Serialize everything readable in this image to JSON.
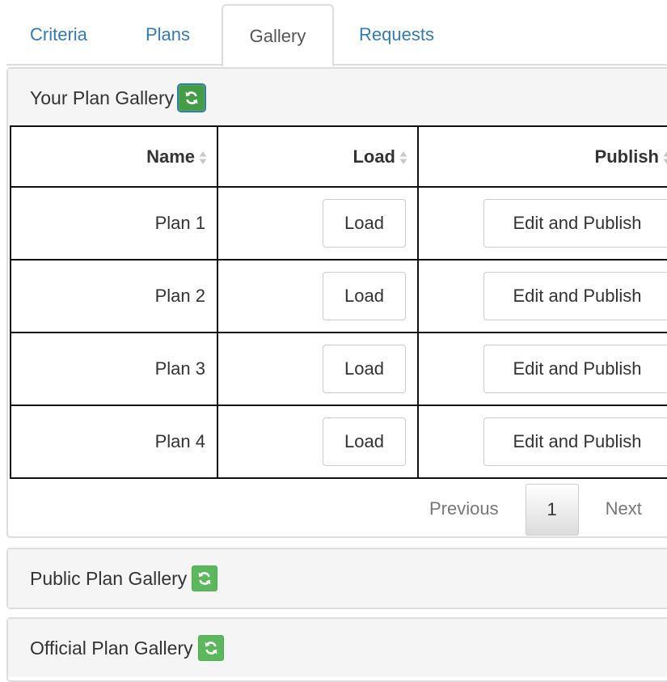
{
  "tabs": {
    "criteria": "Criteria",
    "plans": "Plans",
    "gallery": "Gallery",
    "requests": "Requests",
    "active": "Gallery"
  },
  "your_gallery": {
    "title": "Your Plan Gallery",
    "columns": {
      "name": "Name",
      "load": "Load",
      "publish": "Publish"
    },
    "rows": [
      {
        "name": "Plan 1",
        "load_label": "Load",
        "publish_label": "Edit and Publish"
      },
      {
        "name": "Plan 2",
        "load_label": "Load",
        "publish_label": "Edit and Publish"
      },
      {
        "name": "Plan 3",
        "load_label": "Load",
        "publish_label": "Edit and Publish"
      },
      {
        "name": "Plan 4",
        "load_label": "Load",
        "publish_label": "Edit and Publish"
      }
    ],
    "pagination": {
      "previous": "Previous",
      "current": "1",
      "next": "Next"
    }
  },
  "public_gallery": {
    "title": "Public Plan Gallery"
  },
  "official_gallery": {
    "title": "Official Plan Gallery"
  },
  "icons": {
    "refresh": "refresh-icon",
    "sort": "sort-icon"
  },
  "colors": {
    "link": "#337ab7",
    "refresh_button": "#5cb85c",
    "panel_heading_bg": "#f5f5f5",
    "border": "#dddddd"
  }
}
